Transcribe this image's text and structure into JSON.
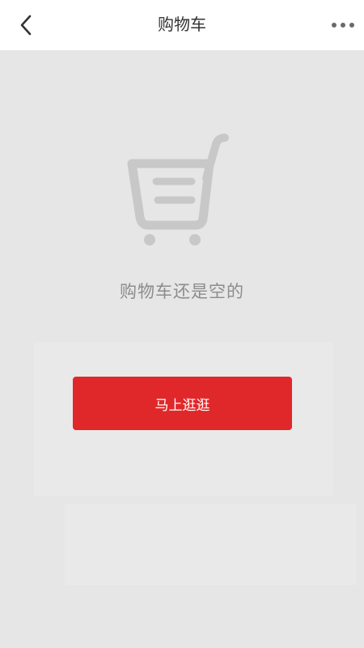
{
  "header": {
    "title": "购物车",
    "back_icon": "chevron-left-icon",
    "more_icon": "more-horizontal-icon"
  },
  "empty_state": {
    "illustration_icon": "shopping-cart-icon",
    "message": "购物车还是空的",
    "button_label": "马上逛逛"
  },
  "colors": {
    "background": "#e6e6e6",
    "header_bg": "#ffffff",
    "accent": "#e0282a",
    "illustration": "#c8c8c8",
    "message_text": "#8c8c8c"
  }
}
